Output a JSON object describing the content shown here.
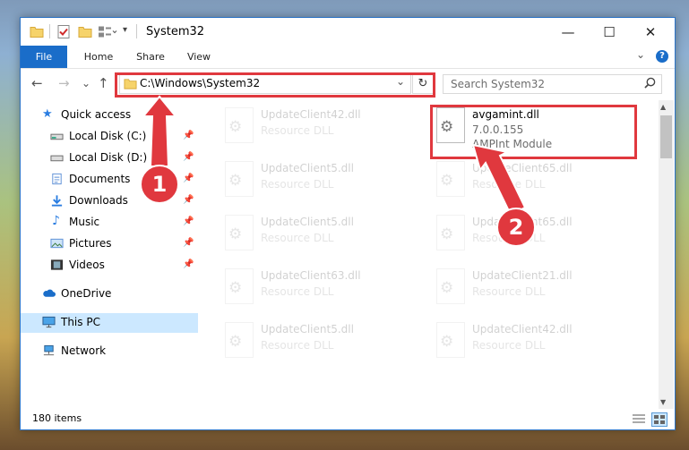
{
  "window": {
    "title": "System32",
    "minimize": "—",
    "maximize": "☐",
    "close": "✕"
  },
  "ribbon": {
    "tabs": [
      "File",
      "Home",
      "Share",
      "View"
    ],
    "collapse": "⌄",
    "help": "?"
  },
  "nav": {
    "back": "←",
    "forward": "→",
    "recent": "⌄",
    "up": "↑"
  },
  "address": {
    "path": "C:\\Windows\\System32",
    "dropdown": "⌄",
    "refresh": "↻"
  },
  "search": {
    "placeholder": "Search System32",
    "icon": "search-icon"
  },
  "sidebar": {
    "items": [
      {
        "label": "Quick access",
        "icon": "star-icon"
      },
      {
        "label": "Local Disk (C:)",
        "icon": "drive-icon",
        "pinned": true
      },
      {
        "label": "Local Disk (D:)",
        "icon": "drive-icon",
        "pinned": true
      },
      {
        "label": "Documents",
        "icon": "documents-icon",
        "pinned": true
      },
      {
        "label": "Downloads",
        "icon": "downloads-icon",
        "pinned": true
      },
      {
        "label": "Music",
        "icon": "music-icon",
        "pinned": true
      },
      {
        "label": "Pictures",
        "icon": "pictures-icon",
        "pinned": true
      },
      {
        "label": "Videos",
        "icon": "videos-icon",
        "pinned": true
      },
      {
        "label": "OneDrive",
        "icon": "cloud-icon"
      },
      {
        "label": "This PC",
        "icon": "computer-icon",
        "selected": true
      },
      {
        "label": "Network",
        "icon": "network-icon"
      }
    ]
  },
  "files": {
    "highlighted": {
      "name": "avgamint.dll",
      "version": "7.0.0.155",
      "description": "AMPInt Module"
    },
    "left_column": [
      {
        "name": "UpdateClient42.dll",
        "type": "Resource DLL"
      },
      {
        "name": "UpdateClient5.dll",
        "type": "Resource DLL"
      },
      {
        "name": "UpdateClient5.dll",
        "type": "Resource DLL"
      },
      {
        "name": "UpdateClient63.dll",
        "type": "Resource DLL"
      },
      {
        "name": "UpdateClient5.dll",
        "type": "Resource DLL"
      }
    ],
    "right_column": [
      {
        "name": "UpdateClient65.dll",
        "type": "Resource DLL"
      },
      {
        "name": "UpdateClient65.dll",
        "type": "Resource DLL"
      },
      {
        "name": "UpdateClient21.dll",
        "type": "Resource DLL"
      },
      {
        "name": "UpdateClient42.dll",
        "type": "Resource DLL"
      }
    ]
  },
  "status": {
    "items": "180 items"
  },
  "annotations": {
    "badge1": "1",
    "badge2": "2",
    "color": "#e0383e"
  },
  "colors": {
    "accent": "#1a6dc9",
    "selected_bg": "#cce8ff",
    "highlight": "#e0383e"
  }
}
